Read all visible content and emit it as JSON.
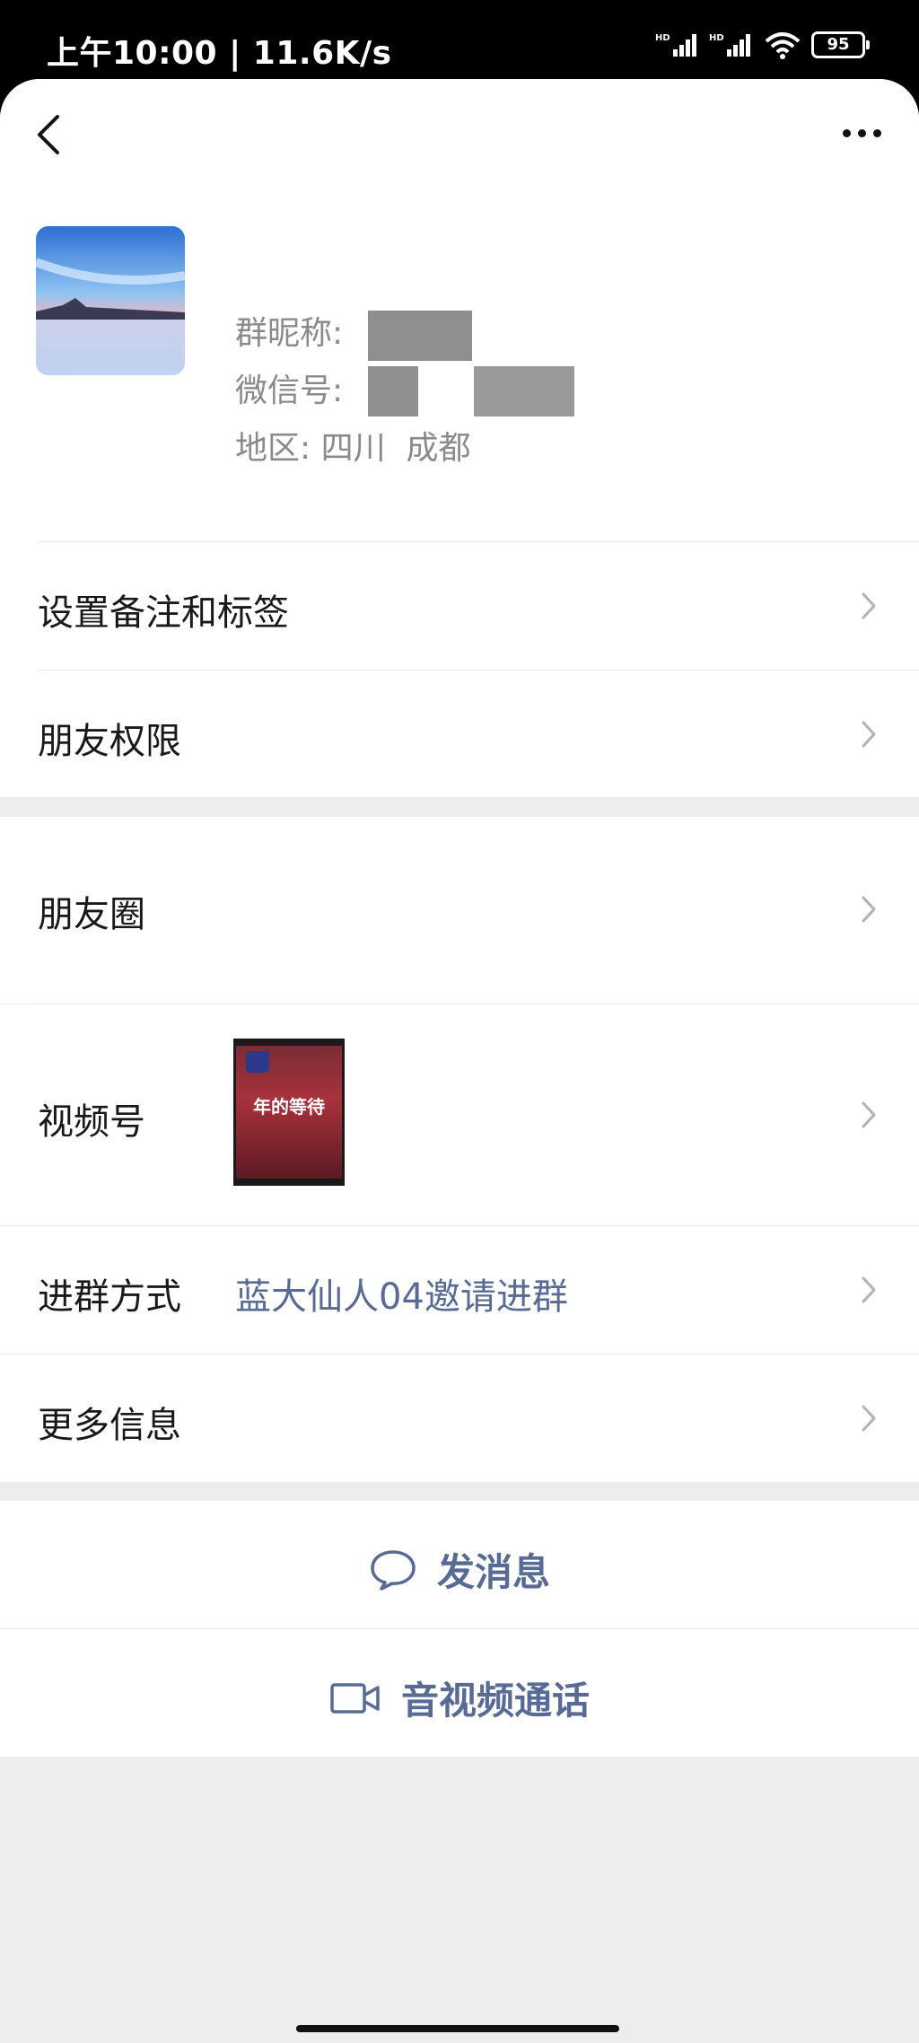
{
  "status_bar": {
    "time_speed": "上午10:00 | 11.6K/s",
    "signal1_label": "HD",
    "signal2_label": "HD",
    "battery": "95"
  },
  "profile": {
    "group_nickname_label": "群昵称:",
    "wechat_id_label": "微信号:",
    "region_label": "地区:",
    "region_value": "四川  成都"
  },
  "rows": {
    "remark_tags": "设置备注和标签",
    "friend_permissions": "朋友权限",
    "moments": "朋友圈",
    "channels": "视频号",
    "channels_thumb_caption": "年的等待",
    "join_method_label": "进群方式",
    "join_method_value": "蓝大仙人04邀请进群",
    "more_info": "更多信息"
  },
  "actions": {
    "send_message": "发消息",
    "video_call": "音视频通话"
  },
  "colors": {
    "accent": "#576b95",
    "background": "#ededed"
  }
}
